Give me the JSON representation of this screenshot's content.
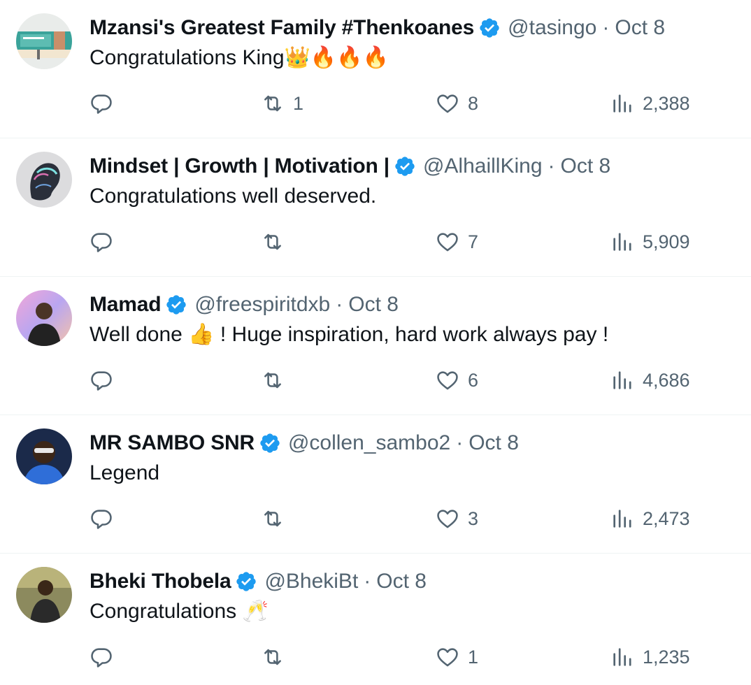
{
  "colors": {
    "accent": "#1d9bf0",
    "muted": "#536471",
    "text": "#0f1419",
    "divider": "#eff3f4"
  },
  "replies": [
    {
      "name": "Mzansi's Greatest Family #Thenkoanes",
      "handle": "@tasingo",
      "separator": "·",
      "date": "Oct 8",
      "text": "Congratulations King👑🔥🔥🔥",
      "retweets": "1",
      "likes": "8",
      "views": "2,388"
    },
    {
      "name": "Mindset | Growth | Motivation |",
      "handle": "@AlhaillKing",
      "separator": "·",
      "date": "Oct 8",
      "text": "Congratulations well deserved.",
      "retweets": "",
      "likes": "7",
      "views": "5,909"
    },
    {
      "name": "Mamad",
      "handle": "@freespiritdxb",
      "separator": "·",
      "date": "Oct 8",
      "text": "Well done 👍 ! Huge inspiration, hard work always pay !",
      "retweets": "",
      "likes": "6",
      "views": "4,686"
    },
    {
      "name": "MR SAMBO SNR",
      "handle": "@collen_sambo2",
      "separator": "·",
      "date": "Oct 8",
      "text": "Legend",
      "retweets": "",
      "likes": "3",
      "views": "2,473"
    },
    {
      "name": "Bheki Thobela",
      "handle": "@BhekiBt",
      "separator": "·",
      "date": "Oct 8",
      "text": "Congratulations 🥂",
      "retweets": "",
      "likes": "1",
      "views": "1,235"
    }
  ],
  "icons": {
    "verified": "verified-badge-icon",
    "reply": "reply-icon",
    "retweet": "retweet-icon",
    "like": "heart-icon",
    "views": "views-chart-icon"
  }
}
